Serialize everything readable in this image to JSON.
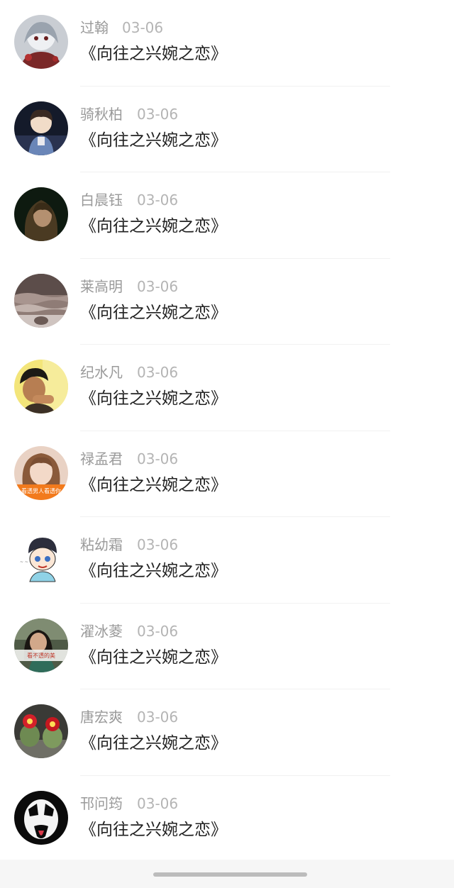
{
  "comments": [
    {
      "name": "过翰",
      "date": "03-06",
      "message": "《向往之兴婉之恋》"
    },
    {
      "name": "骑秋柏",
      "date": "03-06",
      "message": "《向往之兴婉之恋》"
    },
    {
      "name": "白晨钰",
      "date": "03-06",
      "message": "《向往之兴婉之恋》"
    },
    {
      "name": "莱高明",
      "date": "03-06",
      "message": "《向往之兴婉之恋》"
    },
    {
      "name": "纪水凡",
      "date": "03-06",
      "message": "《向往之兴婉之恋》"
    },
    {
      "name": "禄孟君",
      "date": "03-06",
      "message": "《向往之兴婉之恋》"
    },
    {
      "name": "粘幼霜",
      "date": "03-06",
      "message": "《向往之兴婉之恋》"
    },
    {
      "name": "濯冰菱",
      "date": "03-06",
      "message": "《向往之兴婉之恋》"
    },
    {
      "name": "唐宏爽",
      "date": "03-06",
      "message": "《向往之兴婉之恋》"
    },
    {
      "name": "邗问筠",
      "date": "03-06",
      "message": "《向往之兴婉之恋》"
    }
  ],
  "avatar_text": {
    "avatar_6": "看透男人看透你",
    "avatar_8": "看不透的美"
  },
  "colors": {
    "name": "#9a9a9a",
    "date": "#b4b4b4",
    "message": "#222222",
    "divider": "#f1f1f1",
    "footer": "#f6f6f6",
    "home_indicator": "#bcbcbc"
  }
}
